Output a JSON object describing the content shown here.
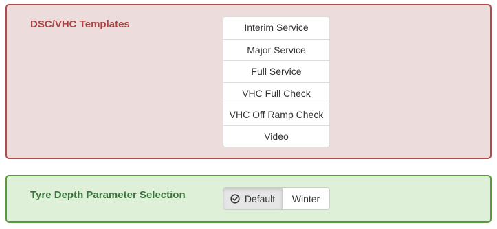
{
  "templates_panel": {
    "title": "DSC/VHC Templates",
    "items": [
      {
        "label": "Interim Service"
      },
      {
        "label": "Major Service"
      },
      {
        "label": "Full Service"
      },
      {
        "label": "VHC Full Check"
      },
      {
        "label": "VHC Off Ramp Check"
      },
      {
        "label": "Video"
      }
    ]
  },
  "tyre_panel": {
    "title": "Tyre Depth Parameter Selection",
    "options": [
      {
        "label": "Default",
        "selected": true,
        "icon": "check-circle-icon"
      },
      {
        "label": "Winter",
        "selected": false
      }
    ]
  },
  "colors": {
    "danger_bg": "#ecdcdc",
    "danger_border": "#b24a4d",
    "danger_text": "#a94442",
    "success_bg": "#dff0d8",
    "success_border": "#5a9a3c",
    "success_text": "#3c763d"
  }
}
